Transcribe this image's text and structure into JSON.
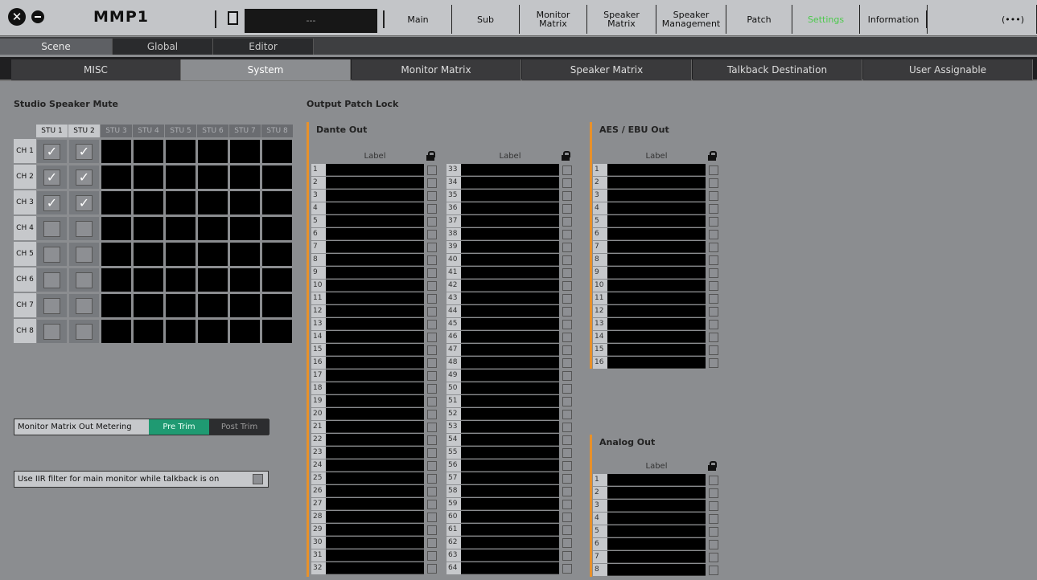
{
  "topbar": {
    "logo": "MMP1",
    "scene_name": "---",
    "nav": [
      "Main",
      "Sub",
      "Monitor\nMatrix",
      "Speaker\nMatrix",
      "Speaker\nManagement",
      "Patch",
      "Settings",
      "Information",
      "(•••)"
    ],
    "active_nav": "Settings",
    "active_color": "#4cc94c"
  },
  "subtabs": [
    "Scene",
    "Global",
    "Editor"
  ],
  "tabs": [
    "MISC",
    "System",
    "Monitor Matrix",
    "Speaker Matrix",
    "Talkback Destination",
    "User Assignable"
  ],
  "studio_speaker_mute": {
    "title": "Studio Speaker Mute",
    "columns": [
      "STU 1",
      "STU 2",
      "STU 3",
      "STU 4",
      "STU 5",
      "STU 6",
      "STU 7",
      "STU 8"
    ],
    "rows": [
      "CH 1",
      "CH 2",
      "CH 3",
      "CH 4",
      "CH 5",
      "CH 6",
      "CH 7",
      "CH 8"
    ],
    "checked": [
      [
        true,
        true
      ],
      [
        true,
        true
      ],
      [
        true,
        true
      ],
      [
        false,
        false
      ],
      [
        false,
        false
      ],
      [
        false,
        false
      ],
      [
        false,
        false
      ],
      [
        false,
        false
      ]
    ],
    "check_glyph": "✓"
  },
  "metering": {
    "label": "Monitor Matrix Out Metering",
    "options": [
      "Pre Trim",
      "Post Trim"
    ],
    "selected": "Pre Trim"
  },
  "iir": {
    "label": "Use IIR filter for main monitor while talkback is on",
    "checked": false
  },
  "patch_lock": {
    "title": "Output Patch Lock",
    "label_header": "Label",
    "dante": {
      "title": "Dante Out",
      "count": 64
    },
    "aes": {
      "title": "AES / EBU Out",
      "count": 16
    },
    "analog": {
      "title": "Analog Out",
      "count": 8
    }
  }
}
